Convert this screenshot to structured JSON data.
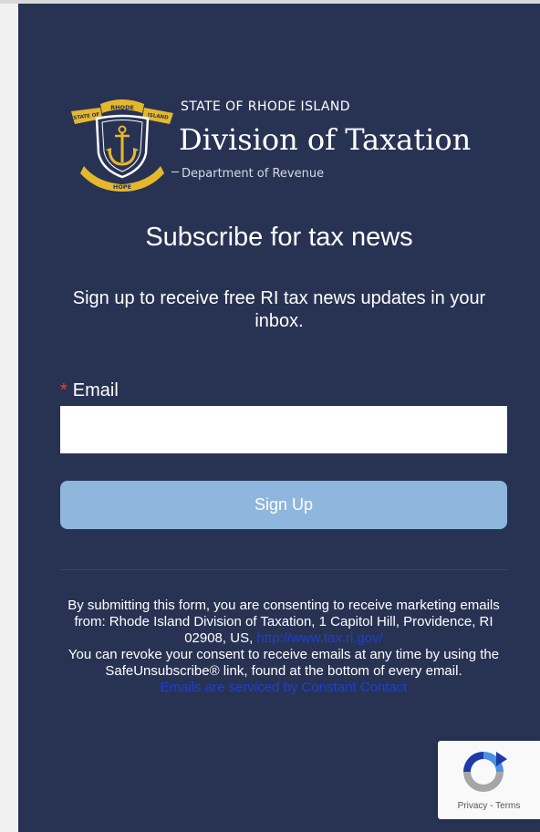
{
  "logo": {
    "state_text": "STATE OF RHODE ISLAND",
    "division_text": "Division of Taxation",
    "department_text": "Department of Revenue",
    "seal_top_text": "RHODE",
    "seal_left_text": "STATE OF",
    "seal_right_text": "ISLAND",
    "seal_bottom_text": "HOPE"
  },
  "form": {
    "title": "Subscribe for tax news",
    "description": "Sign up to receive free RI tax news updates in your inbox.",
    "email_required_mark": "*",
    "email_label": "Email",
    "email_value": "",
    "signup_label": "Sign Up"
  },
  "legal": {
    "consent_text": "By submitting this form, you are consenting to receive marketing emails from: Rhode Island Division of Taxation, 1 Capitol Hill, Providence, RI 02908, US,",
    "consent_link": "http://www.tax.ri.gov/",
    "revoke_text": "You can revoke your consent to receive emails at any time by using the SafeUnsubscribe® link, found at the bottom of every email.",
    "serviced_link": "Emails are serviced by Constant Contact"
  },
  "recaptcha": {
    "privacy": "Privacy",
    "separator": " - ",
    "terms": "Terms"
  },
  "colors": {
    "panel_background": "#283354",
    "button_background": "#8fb6dc",
    "required_mark": "#e2413b",
    "link": "#1a3fd6",
    "seal_gold": "#e5b82c"
  }
}
